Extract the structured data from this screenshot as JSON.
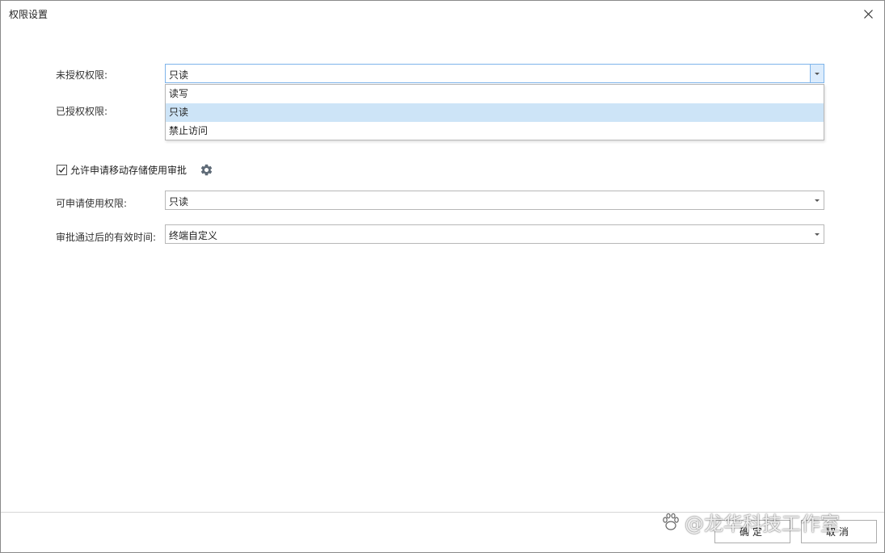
{
  "window": {
    "title": "权限设置"
  },
  "form": {
    "unauthorized_label": "未授权权限:",
    "unauthorized_value": "只读",
    "authorized_label": "已授权权限:",
    "dropdown_options": [
      "读写",
      "只读",
      "禁止访问"
    ],
    "dropdown_selected_index": 1,
    "allow_checkbox_label": "允许申请移动存储使用审批",
    "allow_checkbox_checked": true,
    "apply_perm_label": "可申请使用权限:",
    "apply_perm_value": "只读",
    "valid_time_label": "审批通过后的有效时间:",
    "valid_time_value": "终端自定义"
  },
  "footer": {
    "ok_label": "确定",
    "cancel_label": "取消"
  },
  "watermark": {
    "text": "@龙华科技工作室"
  },
  "icons": {
    "close": "close-icon",
    "gear": "gear-icon",
    "check": "check-icon",
    "dropdown": "chevron-down-icon"
  }
}
